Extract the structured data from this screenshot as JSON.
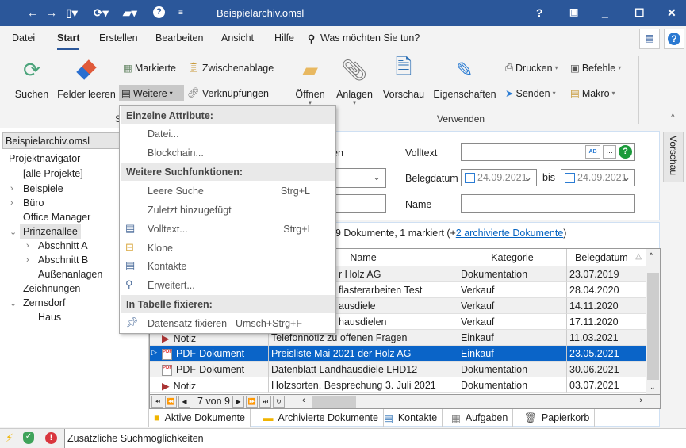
{
  "window": {
    "title": "Beispielarchiv.omsl",
    "controls": [
      "?",
      "restore-ribbon",
      "minimize",
      "maximize",
      "close"
    ]
  },
  "quick_access": [
    "back-icon",
    "forward-icon",
    "new-document-icon",
    "refresh-icon",
    "open-folder-icon",
    "help-icon",
    "customize-icon"
  ],
  "menu_tabs": [
    "Datei",
    "Start",
    "Erstellen",
    "Bearbeiten",
    "Ansicht",
    "Hilfe"
  ],
  "active_tab": "Start",
  "tell_me": "Was möchten Sie tun?",
  "ribbon": {
    "suchen": "Suchen",
    "felder_leeren": "Felder leeren",
    "markierte": "Markierte",
    "weitere": "Weitere",
    "zwischenablage": "Zwischenablage",
    "verknuepfungen": "Verknüpfungen",
    "group_search": "S",
    "oeffnen": "Öffnen",
    "anlagen": "Anlagen",
    "vorschau": "Vorschau",
    "eigenschaften": "Eigenschaften",
    "drucken": "Drucken",
    "senden": "Senden",
    "befehle": "Befehle",
    "makro": "Makro",
    "group_verwenden": "Verwenden"
  },
  "sidebar": {
    "archive": "Beispielarchiv.omsl",
    "title": "Projektnavigator",
    "items": [
      {
        "label": "[alle Projekte]"
      },
      {
        "label": "Beispiele"
      },
      {
        "label": "Büro"
      },
      {
        "label": "Office Manager"
      },
      {
        "label": "Prinzenallee"
      },
      {
        "label": "Abschnitt A"
      },
      {
        "label": "Abschnitt B"
      },
      {
        "label": "Außenanlagen"
      },
      {
        "label": "Zeichnungen"
      },
      {
        "label": "Zernsdorf"
      },
      {
        "label": "Haus"
      }
    ],
    "selected": "Prinzenallee"
  },
  "search": {
    "partial_label": "en",
    "volltext_label": "Volltext",
    "volltext_value": "",
    "belegdatum_label": "Belegdatum",
    "date_from": "24.09.2021",
    "bis": "bis",
    "date_to": "24.09.2021",
    "name_label": "Name",
    "name_value": "",
    "vorschau_tab": "Vorschau"
  },
  "results": {
    "count_text": "9 Dokumente, 1 markiert (+",
    "archived_link": "2 archivierte Dokumente",
    "count_close": ")"
  },
  "table": {
    "columns": [
      "Name",
      "Kategorie",
      "Belegdatum"
    ],
    "rows": [
      {
        "type": "",
        "name": "r Holz AG",
        "category": "Dokumentation",
        "date": "23.07.2019"
      },
      {
        "type": "",
        "name": "flasterarbeiten Test",
        "category": "Verkauf",
        "date": "28.04.2020"
      },
      {
        "type": "",
        "name": "ausdiele",
        "category": "Verkauf",
        "date": "14.11.2020"
      },
      {
        "type": "",
        "name": "hausdielen",
        "category": "Verkauf",
        "date": "17.11.2020"
      },
      {
        "type": "Notiz",
        "name": "Telefonnotiz zu offenen Fragen",
        "category": "Einkauf",
        "date": "11.03.2021"
      },
      {
        "type": "PDF-Dokument",
        "name": "Preisliste Mai 2021 der Holz AG",
        "category": "Einkauf",
        "date": "23.05.2021",
        "selected": true
      },
      {
        "type": "PDF-Dokument",
        "name": "Datenblatt Landhausdiele LHD12",
        "category": "Dokumentation",
        "date": "30.06.2021"
      },
      {
        "type": "Notiz",
        "name": "Holzsorten, Besprechung 3. Juli 2021",
        "category": "Dokumentation",
        "date": "03.07.2021"
      }
    ],
    "pager": "7 von 9"
  },
  "bottom_tabs": [
    "Aktive Dokumente",
    "Archivierte Dokumente",
    "Kontakte",
    "Aufgaben",
    "Papierkorb"
  ],
  "status": {
    "text": "Zusätzliche Suchmöglichkeiten"
  },
  "dropdown": {
    "h1": "Einzelne Attribute:",
    "datei": "Datei...",
    "blockchain": "Blockchain...",
    "h2": "Weitere Suchfunktionen:",
    "leere": "Leere Suche",
    "leere_sc": "Strg+L",
    "zuletzt": "Zuletzt hinzugefügt",
    "volltext": "Volltext...",
    "volltext_sc": "Strg+I",
    "klone": "Klone",
    "kontakte": "Kontakte",
    "erweitert": "Erweitert...",
    "h3": "In Tabelle fixieren:",
    "fixieren": "Datensatz fixieren",
    "fixieren_sc": "Umsch+Strg+F"
  },
  "colors": {
    "titlebar": "#2b579a",
    "selection": "#0a64c8",
    "link": "#0563c1"
  }
}
